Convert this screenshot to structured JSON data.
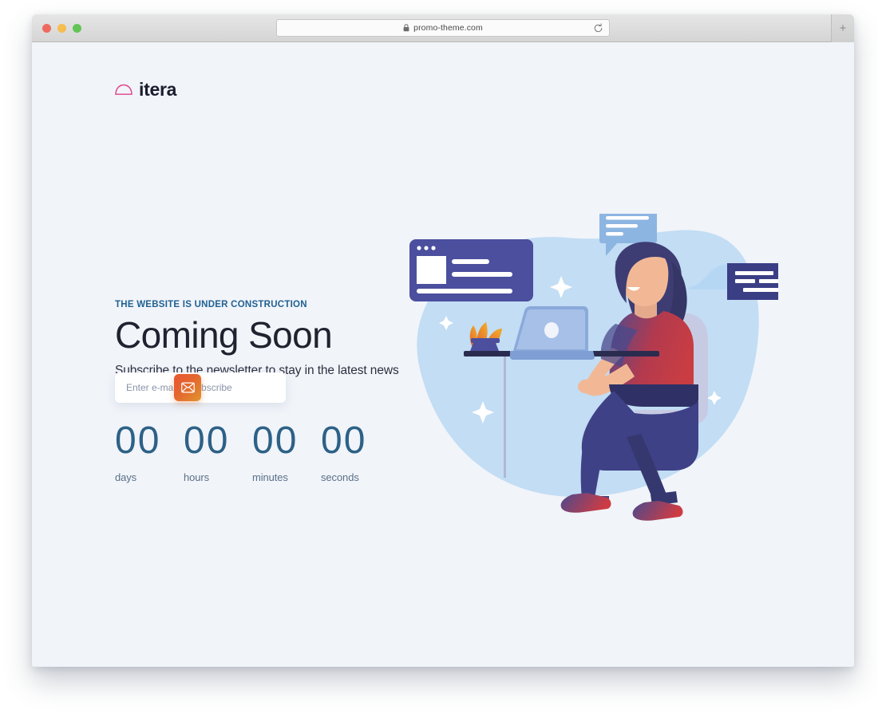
{
  "browser": {
    "url": "promo-theme.com",
    "lock_icon": "lock-icon",
    "reload_icon": "reload-icon",
    "new_tab_label": "+",
    "traffic_lights": [
      "close-red",
      "minimize-yellow",
      "maximize-green"
    ]
  },
  "site": {
    "logo_text": "itera",
    "logo_icon": "cloud-arc-icon",
    "logo_color": "#e0408c"
  },
  "hero": {
    "eyebrow": "THE WEBSITE IS UNDER CONSTRUCTION",
    "headline": "Coming Soon",
    "subline": "Subscribe to the newsletter to stay in the latest news"
  },
  "subscribe": {
    "placeholder": "Enter e-mail to subscribe",
    "value": "",
    "button_icon": "envelope-icon",
    "button_gradient_from": "#e9562f",
    "button_gradient_to": "#e1942c"
  },
  "countdown": {
    "units": [
      {
        "value": "00",
        "label": "days"
      },
      {
        "value": "00",
        "label": "hours"
      },
      {
        "value": "00",
        "label": "minutes"
      },
      {
        "value": "00",
        "label": "seconds"
      }
    ]
  },
  "theme": {
    "page_background": "#f1f4f9",
    "eyebrow_blue": "#1f6193",
    "headline_dark": "#20222f",
    "countdown_blue": "#2d6187",
    "countdown_label": "#5a7089",
    "illustration_blob": "#c2ddf4",
    "illustration_indigo": "#4b4f9e",
    "illustration_dark_indigo": "#3a3e85",
    "illustration_bubble": "#8cb5e2",
    "illustration_shirt_red": "#c73a46",
    "illustration_hair": "#3d3d73"
  },
  "illustration": {
    "name": "woman-working-at-laptop-illustration",
    "elements": [
      "background-blob",
      "browser-card-left",
      "speech-bubble",
      "cloud-shape",
      "info-card-right",
      "desk",
      "laptop",
      "potted-plant",
      "chair",
      "woman-figure",
      "sparkles"
    ]
  }
}
